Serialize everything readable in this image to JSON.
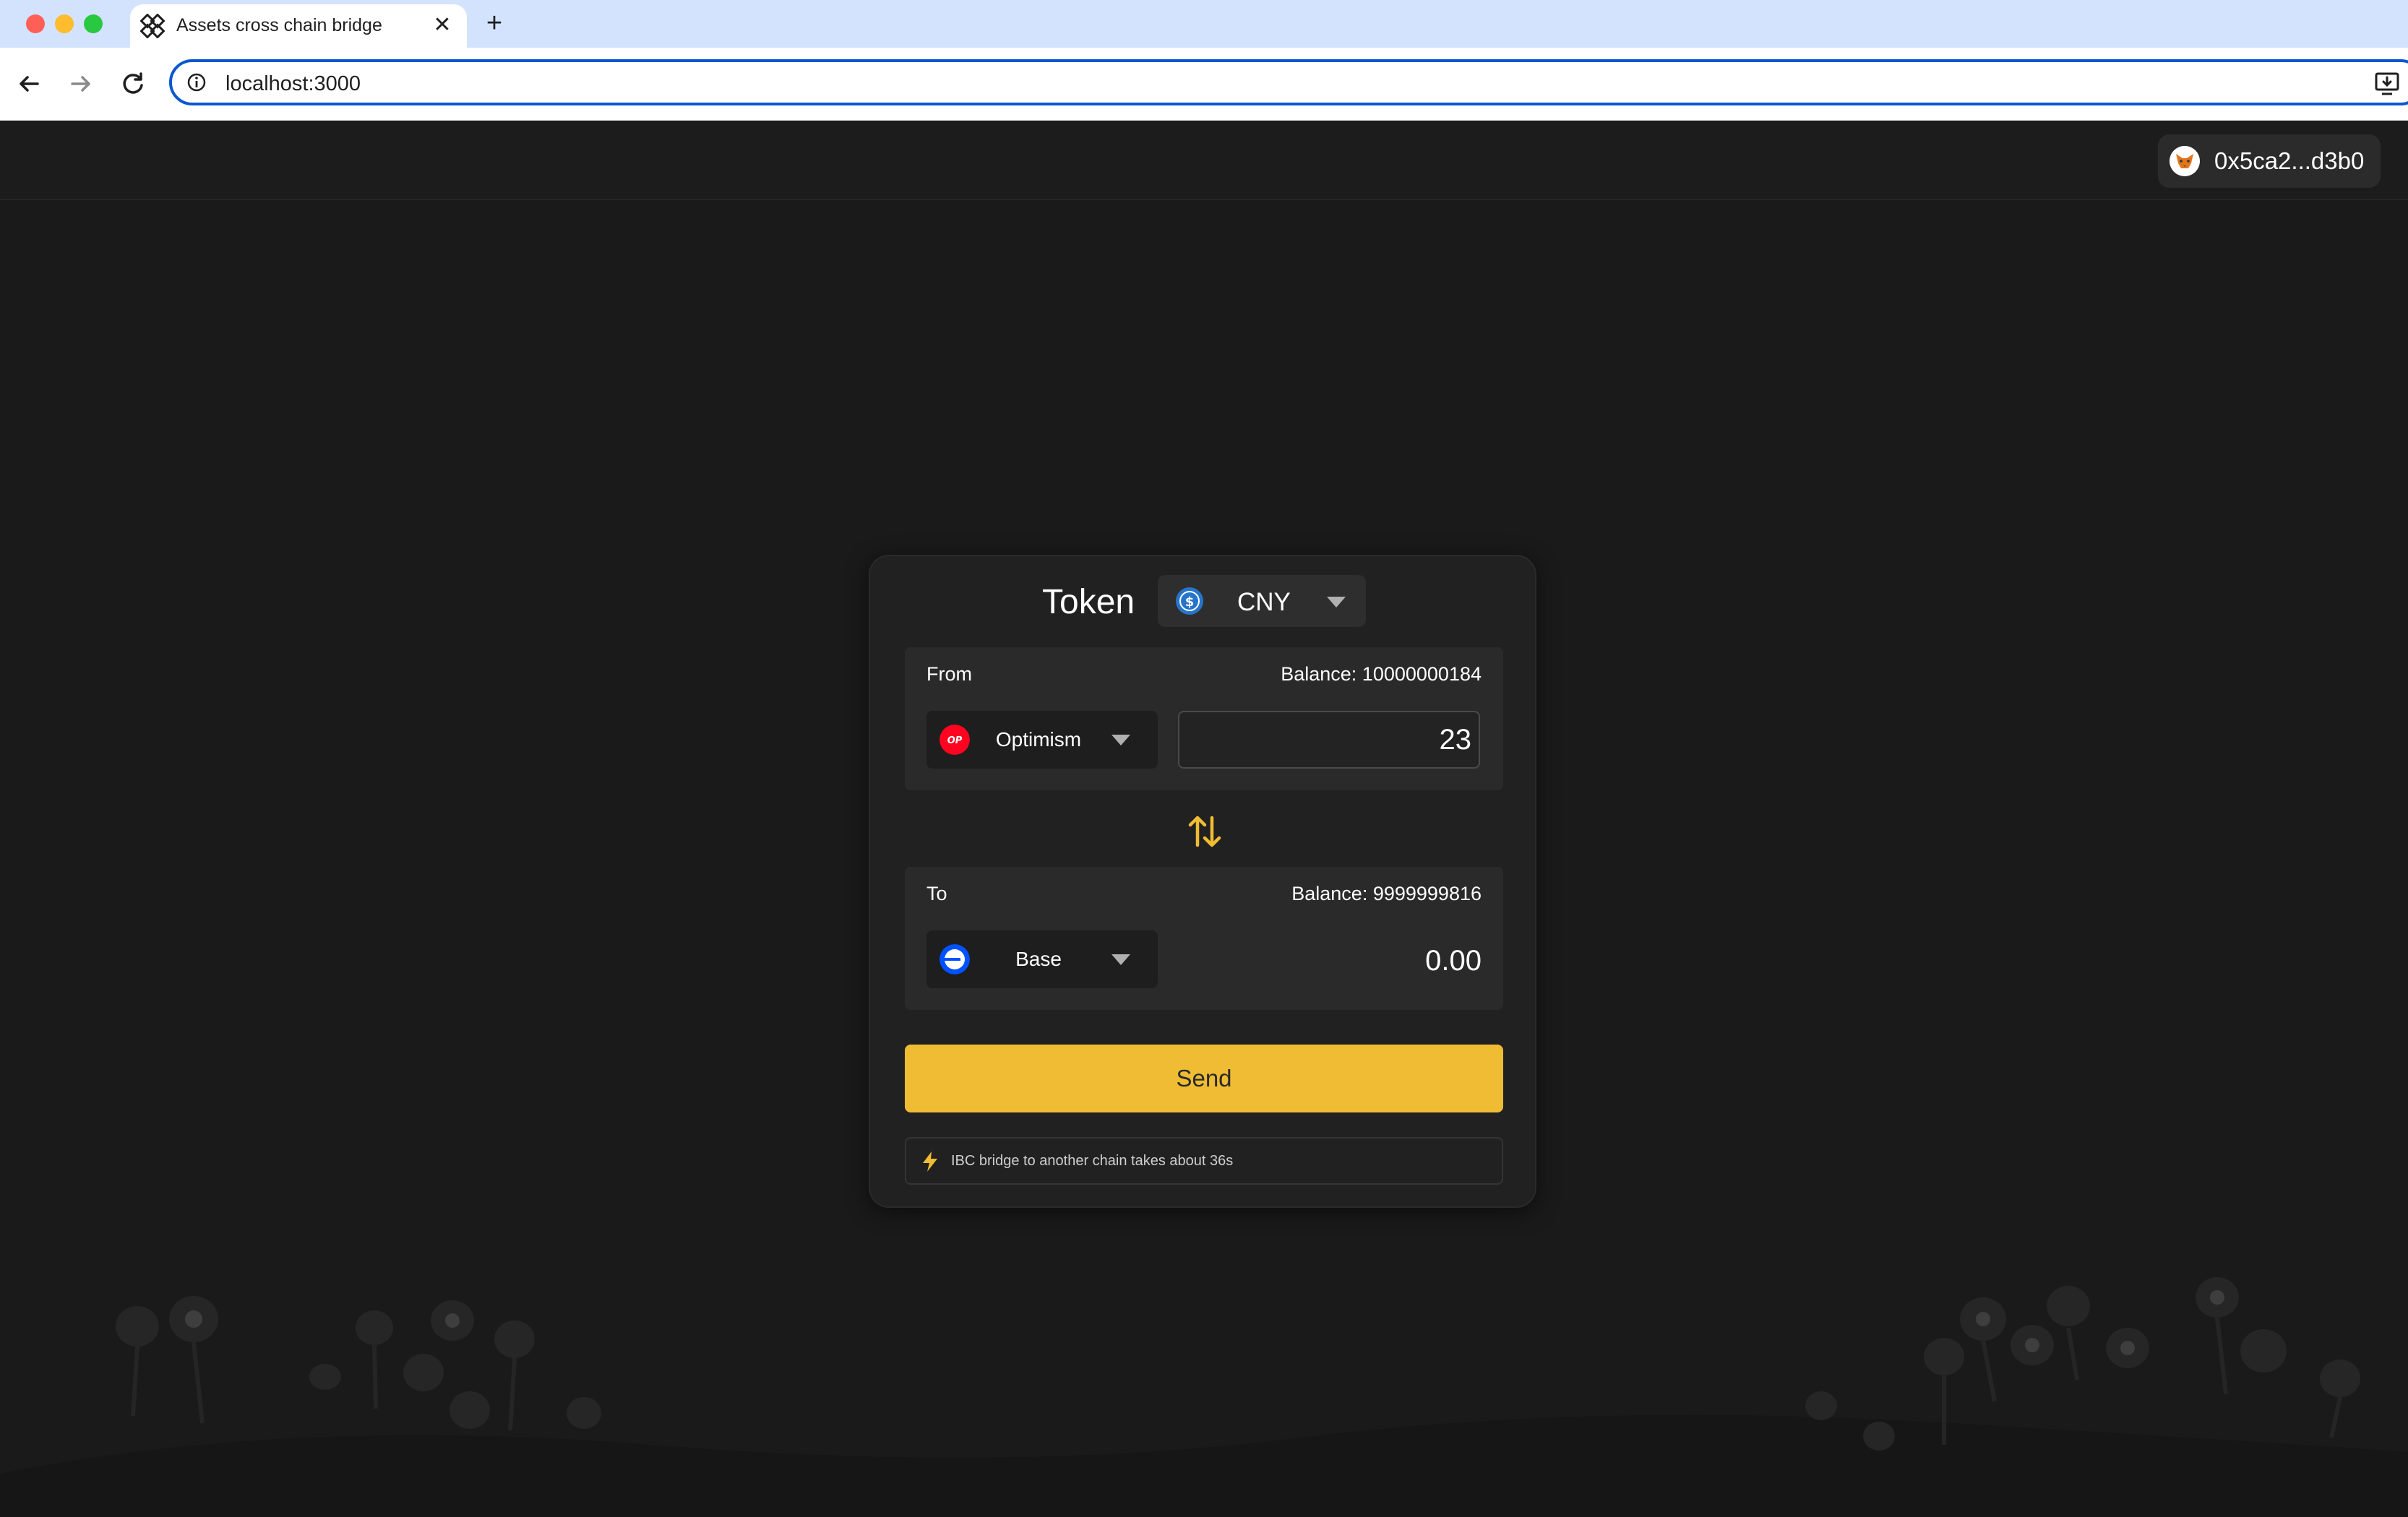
{
  "browser": {
    "tab_title": "Assets cross chain bridge",
    "new_tab": "+",
    "close": "✕",
    "url": "localhost:3000"
  },
  "header": {
    "wallet_address": "0x5ca2...d3b0",
    "wallet_icon": "metamask-fox-icon"
  },
  "bridge": {
    "token_label": "Token",
    "token": {
      "name": "CNY",
      "icon": "usdc-coin-icon"
    },
    "from": {
      "label": "From",
      "balance": "Balance: 10000000184",
      "chain": "Optimism",
      "chain_icon": "optimism-icon",
      "amount": "23"
    },
    "to": {
      "label": "To",
      "balance": "Balance: 9999999816",
      "chain": "Base",
      "chain_icon": "base-icon",
      "amount": "0.00"
    },
    "send_label": "Send",
    "notice": "IBC bridge to another chain takes about 36s"
  },
  "colors": {
    "background": "#1a1a1a",
    "card": "#212121",
    "accent": "#f0bc33",
    "optimism": "#ff0420",
    "base": "#0052ff"
  }
}
